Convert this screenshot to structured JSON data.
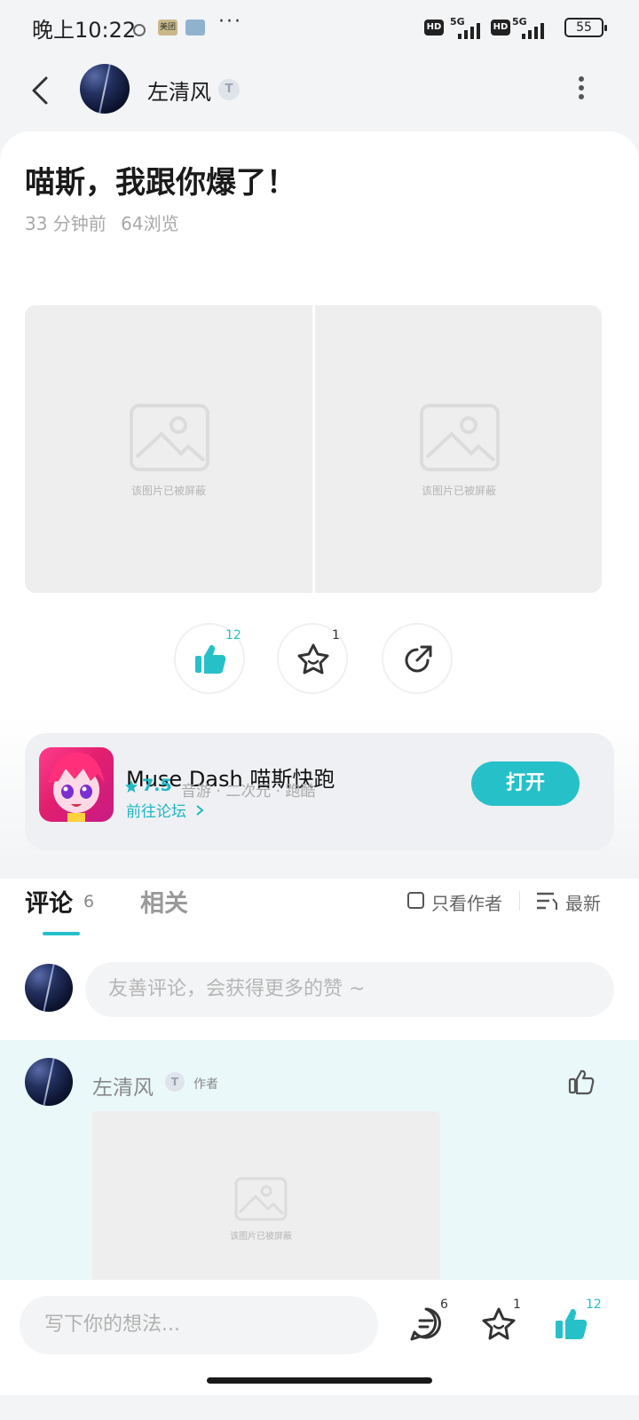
{
  "status_bar": {
    "time": "晚上10:22",
    "app_mini_1": "美团",
    "more": "···",
    "hd_1": "HD",
    "net_1": "5G",
    "hd_2": "HD",
    "net_2": "5G",
    "battery": "55"
  },
  "header": {
    "author_name": "左清风",
    "author_badge": "T"
  },
  "post": {
    "title": "喵斯，我跟你爆了！",
    "time_ago": "33 分钟前",
    "views": "64浏览",
    "blocked_image_text": "该图片已被屏蔽",
    "like_count": "12",
    "favorite_count": "1"
  },
  "game_card": {
    "name": "Muse Dash 喵斯快跑",
    "score": "7.5",
    "tags": "音游 · 二次元 · 跑酷",
    "forum_link": "前往论坛",
    "open_button": "打开"
  },
  "tabs": {
    "comments_label": "评论",
    "comments_count": "6",
    "related_label": "相关",
    "author_only": "只看作者",
    "sort_latest": "最新"
  },
  "comment_input": {
    "placeholder": "友善评论，会获得更多的赞 ~"
  },
  "first_comment": {
    "name": "左清风",
    "badge": "T",
    "tag": "作者",
    "blocked_image_text": "该图片已被屏蔽"
  },
  "bottom_bar": {
    "placeholder": "写下你的想法...",
    "comment_count": "6",
    "favorite_count": "1",
    "like_count": "12"
  },
  "colors": {
    "accent": "#26c0c9",
    "comment_bg": "#eaf8fa"
  }
}
